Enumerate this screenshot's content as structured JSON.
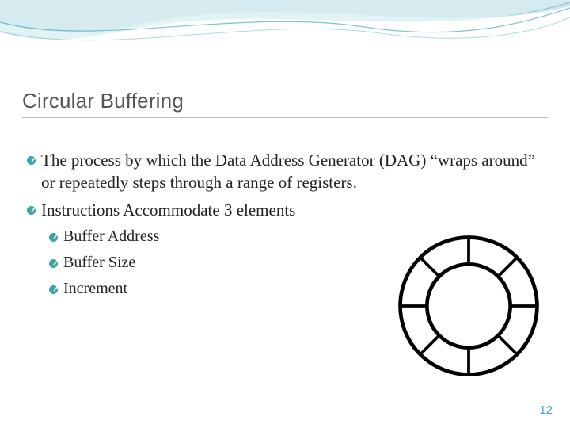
{
  "slide": {
    "title": "Circular Buffering",
    "page_number": "12"
  },
  "bullets": {
    "b1": "The process by which the Data Address Generator (DAG) “wraps around” or repeatedly steps through a range of registers.",
    "b2": "Instructions Accommodate 3 elements",
    "sub1": "Buffer Address",
    "sub2": "Buffer Size",
    "sub3": "Increment"
  },
  "diagram": {
    "name": "ring-buffer-diagram",
    "segments": 8
  },
  "theme": {
    "accent": "#3aa6a3",
    "wave_top": "#0d6aa0",
    "wave_mid": "#2aa7b5",
    "page_num_color": "#43a6c9"
  }
}
